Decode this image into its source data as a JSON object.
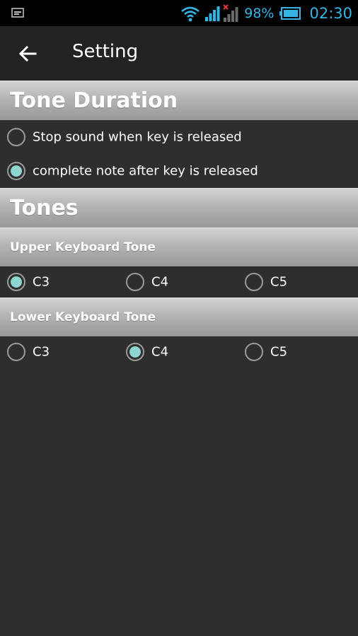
{
  "status_bar": {
    "battery_percent": "98%",
    "time": "02:30",
    "accent_color": "#35b5e5",
    "icons": [
      "notification-icon",
      "wifi-icon",
      "signal-icon",
      "signal-no-sim-icon",
      "battery-icon"
    ]
  },
  "action_bar": {
    "title": "Setting",
    "back_icon": "back-arrow-icon"
  },
  "tone_duration": {
    "header": "Tone Duration",
    "options": [
      {
        "label": "Stop sound when key is released",
        "selected": false
      },
      {
        "label": "complete note after key is released",
        "selected": true
      }
    ]
  },
  "tones": {
    "header": "Tones",
    "upper": {
      "header": "Upper Keyboard Tone",
      "options": [
        {
          "label": "C3",
          "selected": true
        },
        {
          "label": "C4",
          "selected": false
        },
        {
          "label": "C5",
          "selected": false
        }
      ]
    },
    "lower": {
      "header": "Lower Keyboard Tone",
      "options": [
        {
          "label": "C3",
          "selected": false
        },
        {
          "label": "C4",
          "selected": true
        },
        {
          "label": "C5",
          "selected": false
        }
      ]
    }
  },
  "colors": {
    "radio_selected": "#8ed6d0",
    "radio_border": "#9a9a9a",
    "background": "#2e2e2e"
  }
}
